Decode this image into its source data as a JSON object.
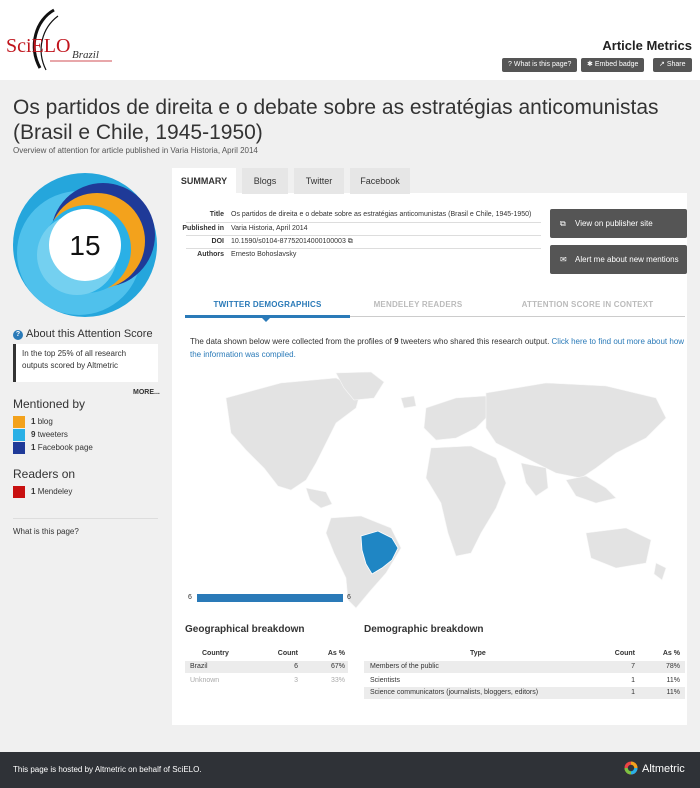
{
  "header": {
    "logo_main": "SciELO",
    "logo_sub": "Brazil",
    "title": "Article Metrics",
    "buttons": [
      {
        "icon": "question-icon",
        "label": "What is this page?"
      },
      {
        "icon": "bookmark-icon",
        "label": "Embed badge"
      },
      {
        "icon": "share-icon",
        "label": "Share"
      }
    ]
  },
  "article": {
    "title": "Os partidos de direita e o debate sobre as estratégias anticomunistas (Brasil e Chile, 1945-1950)",
    "overview": "Overview of attention for article published in Varia Historia, April 2014"
  },
  "score": {
    "value": "15",
    "about_label": "About this Attention Score",
    "rank_text": "In the top 25% of all research outputs scored by Altmetric",
    "more": "MORE..."
  },
  "mentioned": {
    "title": "Mentioned by",
    "items": [
      {
        "count": "1",
        "label": "blog",
        "color": "#f3a21c"
      },
      {
        "count": "9",
        "label": "tweeters",
        "color": "#2ab0e6"
      },
      {
        "count": "1",
        "label": "Facebook page",
        "color": "#1f3a98"
      }
    ]
  },
  "readers": {
    "title": "Readers on",
    "items": [
      {
        "count": "1",
        "label": "Mendeley",
        "color": "#c81010"
      }
    ]
  },
  "what_is_page": "What is this page?",
  "tabs": [
    "SUMMARY",
    "Blogs",
    "Twitter",
    "Facebook"
  ],
  "summary": {
    "title_label": "Title",
    "title_value": "Os partidos de direita e o debate sobre as estratégias anticomunistas (Brasil e Chile, 1945-1950)",
    "published_label": "Published in",
    "published_value": "Varia Historia, April 2014",
    "doi_label": "DOI",
    "doi_value": "10.1590/s0104-87752014000100003",
    "authors_label": "Authors",
    "authors_value": "Ernesto Bohoslavsky"
  },
  "side_buttons": [
    {
      "icon": "external-link-icon",
      "label": "View on publisher site"
    },
    {
      "icon": "mail-icon",
      "label": "Alert me about new mentions"
    }
  ],
  "subtabs": [
    "TWITTER DEMOGRAPHICS",
    "MENDELEY READERS",
    "ATTENTION SCORE IN CONTEXT"
  ],
  "description": {
    "prefix": "The data shown below were collected from the profiles of ",
    "count": "9",
    "middle": " tweeters who shared this research output. ",
    "link": "Click here to find out more about how the information was compiled."
  },
  "map": {
    "min_label": "6",
    "max_label": "6",
    "highlight_color": "#1f86c4"
  },
  "geo": {
    "title": "Geographical breakdown",
    "headers": [
      "Country",
      "Count",
      "As %"
    ],
    "rows": [
      [
        "Brazil",
        "6",
        "67%"
      ],
      [
        "Unknown",
        "3",
        "33%"
      ]
    ]
  },
  "demo": {
    "title": "Demographic breakdown",
    "headers": [
      "Type",
      "Count",
      "As %"
    ],
    "rows": [
      [
        "Members of the public",
        "7",
        "78%"
      ],
      [
        "Scientists",
        "1",
        "11%"
      ],
      [
        "Science communicators (journalists, bloggers, editors)",
        "1",
        "11%"
      ]
    ]
  },
  "footer": {
    "prefix": "This page is hosted by ",
    "altmetric_link": "Altmetric",
    "middle": " on behalf of ",
    "scielo_link": "SciELO",
    "suffix": ".",
    "brand": "Altmetric"
  }
}
